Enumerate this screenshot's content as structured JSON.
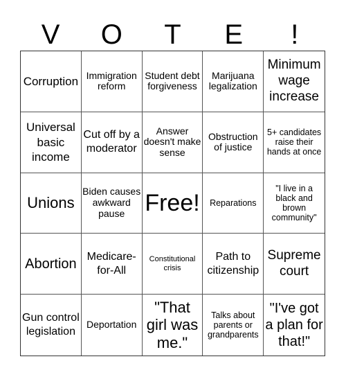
{
  "title_letters": [
    "V",
    "O",
    "T",
    "E",
    "!"
  ],
  "cells": [
    {
      "text": "Corruption",
      "size": "s17"
    },
    {
      "text": "Immigration reform",
      "size": "s14"
    },
    {
      "text": "Student debt forgiveness",
      "size": "s14"
    },
    {
      "text": "Marijuana legalization",
      "size": "s14"
    },
    {
      "text": "Minimum wage increase",
      "size": "s19"
    },
    {
      "text": "Universal basic income",
      "size": "s17"
    },
    {
      "text": "Cut off by a moderator",
      "size": "s16"
    },
    {
      "text": "Answer doesn't make sense",
      "size": "s14"
    },
    {
      "text": "Obstruction of justice",
      "size": "s14"
    },
    {
      "text": "5+ candidates raise their hands at once",
      "size": "s12"
    },
    {
      "text": "Unions",
      "size": "s22"
    },
    {
      "text": "Biden causes awkward pause",
      "size": "s14"
    },
    {
      "text": "Free!",
      "size": "s34"
    },
    {
      "text": "Reparations",
      "size": "s12"
    },
    {
      "text": "\"I live in a black and brown community\"",
      "size": "s12"
    },
    {
      "text": "Abortion",
      "size": "s20"
    },
    {
      "text": "Medicare-for-All",
      "size": "s16"
    },
    {
      "text": "Constitutional crisis",
      "size": "s11"
    },
    {
      "text": "Path to citizenship",
      "size": "s16"
    },
    {
      "text": "Supreme court",
      "size": "s19"
    },
    {
      "text": "Gun control legislation",
      "size": "s16"
    },
    {
      "text": "Deportation",
      "size": "s14"
    },
    {
      "text": "\"That girl was me.\"",
      "size": "s22"
    },
    {
      "text": "Talks about parents or grandparents",
      "size": "s12"
    },
    {
      "text": "\"I've got a plan for that!\"",
      "size": "s20"
    }
  ]
}
